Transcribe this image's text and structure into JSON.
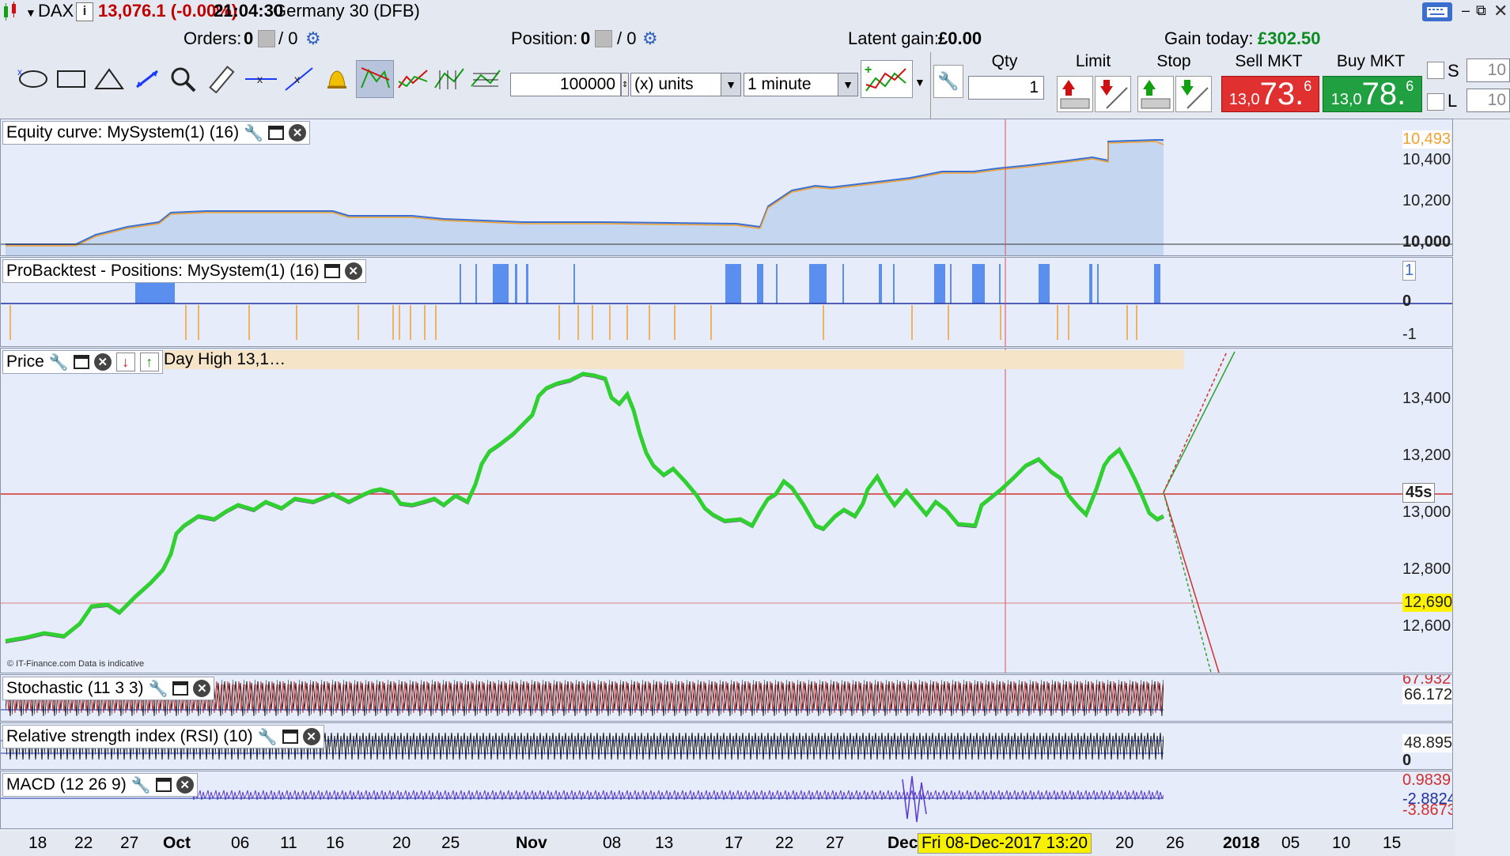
{
  "header": {
    "instrument": "DAX",
    "info_icon": "info-icon",
    "quote": "13,076.1 (-0.00%)",
    "time": "21:04:30",
    "market": "Germany 30 (DFB)",
    "colors": {
      "quote": "#c00000",
      "gain": "#0a8a20"
    }
  },
  "status": {
    "orders_label": "Orders:",
    "orders_value": "0",
    "orders_sep": "/ 0",
    "position_label": "Position:",
    "position_value": "0",
    "position_sep": "/ 0",
    "latent_label": "Latent gain:",
    "latent_value": "£0.00",
    "today_label": "Gain today:",
    "today_value": "£302.50"
  },
  "toolbar": {
    "quantity_value": "100000",
    "units_value": "(x) units",
    "timeframe_value": "1 minute",
    "qty_label": "Qty",
    "qty_value": "1",
    "limit_label": "Limit",
    "stop_label": "Stop",
    "sell_label": "Sell MKT",
    "sell_small": "13,0",
    "sell_big": "73.",
    "sell_sup": "6",
    "buy_label": "Buy MKT",
    "buy_small": "13,0",
    "buy_big": "78.",
    "buy_sup": "6",
    "s_label": "S",
    "s_value": "10",
    "l_label": "L",
    "l_value": "10"
  },
  "panels": {
    "equity": {
      "title": "Equity curve: MySystem(1) (16)",
      "axis": [
        "10,493",
        "10,400",
        "10,200",
        "10,000"
      ]
    },
    "positions": {
      "title": "ProBacktest - Positions: MySystem(1) (16)",
      "axis": [
        "1",
        "0",
        "-1"
      ]
    },
    "price": {
      "title": "Price",
      "overlay": "Day High 13,1…",
      "axis": [
        "13,400",
        "13,200",
        "13,000",
        "12,800",
        "12,690",
        "12,600"
      ],
      "countdown": "45s",
      "watermark": "© IT-Finance.com  Data is indicative"
    },
    "stochastic": {
      "title": "Stochastic (11 3 3)",
      "axis": [
        "67.932",
        "66.172"
      ]
    },
    "rsi": {
      "title": "Relative strength index (RSI) (10)",
      "axis": [
        "48.895",
        "0"
      ]
    },
    "macd": {
      "title": "MACD (12 26 9)",
      "axis": [
        "0.9839",
        "-2.8824",
        "-3.8673"
      ]
    }
  },
  "dates": [
    "18",
    "22",
    "27",
    "Oct",
    "06",
    "11",
    "16",
    "20",
    "25",
    "Nov",
    "08",
    "13",
    "17",
    "22",
    "27",
    "Dec",
    "20",
    "26",
    "2018",
    "05",
    "10",
    "15"
  ],
  "cursor_date": "Fri 08-Dec-2017 13:20"
}
